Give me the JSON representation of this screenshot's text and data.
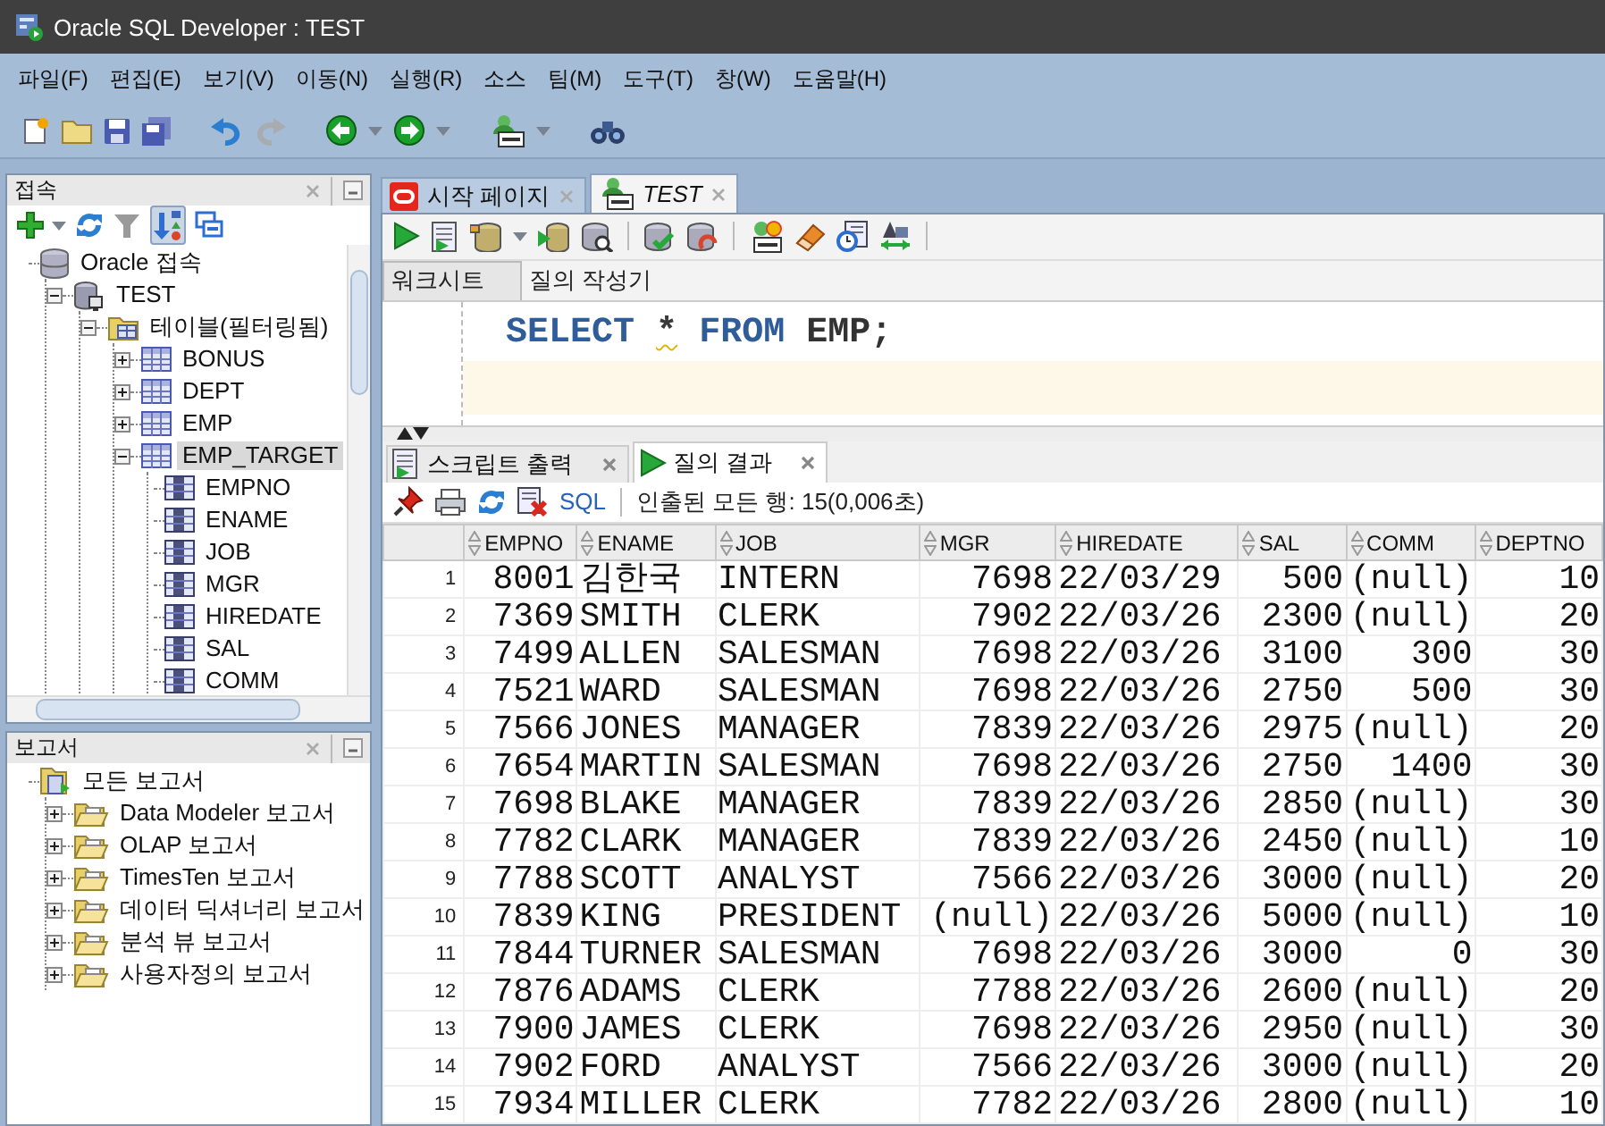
{
  "window": {
    "title": "Oracle SQL Developer : TEST"
  },
  "menu": [
    "파일(F)",
    "편집(E)",
    "보기(V)",
    "이동(N)",
    "실행(R)",
    "소스",
    "팀(M)",
    "도구(T)",
    "창(W)",
    "도움말(H)"
  ],
  "connections_panel": {
    "title": "접속",
    "tree": [
      {
        "label": "Oracle 접속",
        "kind": "database",
        "selected": false,
        "children": [
          {
            "label": "TEST",
            "kind": "connection",
            "selected": false,
            "expanded": true,
            "children": [
              {
                "label": "테이블(필터링됨)",
                "kind": "table-folder",
                "selected": false,
                "expanded": true,
                "children": [
                  {
                    "label": "BONUS",
                    "kind": "table",
                    "selected": false,
                    "expanded": false
                  },
                  {
                    "label": "DEPT",
                    "kind": "table",
                    "selected": false,
                    "expanded": false
                  },
                  {
                    "label": "EMP",
                    "kind": "table",
                    "selected": false,
                    "expanded": false
                  },
                  {
                    "label": "EMP_TARGET",
                    "kind": "table",
                    "selected": true,
                    "expanded": true,
                    "children": [
                      {
                        "label": "EMPNO",
                        "kind": "column",
                        "selected": false
                      },
                      {
                        "label": "ENAME",
                        "kind": "column",
                        "selected": false
                      },
                      {
                        "label": "JOB",
                        "kind": "column",
                        "selected": false
                      },
                      {
                        "label": "MGR",
                        "kind": "column",
                        "selected": false
                      },
                      {
                        "label": "HIREDATE",
                        "kind": "column",
                        "selected": false
                      },
                      {
                        "label": "SAL",
                        "kind": "column",
                        "selected": false
                      },
                      {
                        "label": "COMM",
                        "kind": "column",
                        "selected": false
                      }
                    ]
                  }
                ]
              }
            ]
          }
        ]
      }
    ]
  },
  "reports_panel": {
    "title": "보고서",
    "tree": [
      {
        "label": "모든 보고서",
        "kind": "reports",
        "selected": false,
        "children": [
          {
            "label": "Data Modeler 보고서",
            "kind": "report-folder",
            "selected": false,
            "expanded": false
          },
          {
            "label": "OLAP 보고서",
            "kind": "report-folder",
            "selected": false,
            "expanded": false
          },
          {
            "label": "TimesTen 보고서",
            "kind": "report-folder",
            "selected": false,
            "expanded": false
          },
          {
            "label": "데이터 딕셔너리 보고서",
            "kind": "report-folder",
            "selected": false,
            "expanded": false
          },
          {
            "label": "분석 뷰 보고서",
            "kind": "report-folder",
            "selected": false,
            "expanded": false
          },
          {
            "label": "사용자정의 보고서",
            "kind": "report-folder",
            "selected": false,
            "expanded": false
          }
        ]
      }
    ]
  },
  "editor_tabs": [
    {
      "label": "시작 페이지",
      "kind": "start",
      "selected": false
    },
    {
      "label": "TEST",
      "kind": "worksheet",
      "selected": true
    }
  ],
  "worksheet_tabs": [
    {
      "label": "워크시트",
      "selected": true
    },
    {
      "label": "질의 작성기",
      "selected": false
    }
  ],
  "sql_lines": [
    {
      "current": false,
      "tokens": [
        {
          "text": "SELECT",
          "kind": "keyword",
          "warning": false
        },
        {
          "text": "*",
          "kind": "operator",
          "warning": true
        },
        {
          "text": "FROM",
          "kind": "keyword",
          "warning": false
        },
        {
          "text": "EMP;",
          "kind": "identifier",
          "warning": false
        }
      ]
    },
    {
      "current": true
    }
  ],
  "result_tabs": [
    {
      "label": "스크립트 출력",
      "kind": "script",
      "selected": false
    },
    {
      "label": "질의 결과",
      "kind": "query",
      "selected": true
    }
  ],
  "results_toolbar": {
    "sql_link": "SQL",
    "status": "인출된 모든 행: 15(0,006초)"
  },
  "grid": {
    "columns": [
      {
        "label": "EMPNO",
        "kind": "number"
      },
      {
        "label": "ENAME",
        "kind": "text"
      },
      {
        "label": "JOB",
        "kind": "text"
      },
      {
        "label": "MGR",
        "kind": "number"
      },
      {
        "label": "HIREDATE",
        "kind": "date"
      },
      {
        "label": "SAL",
        "kind": "number"
      },
      {
        "label": "COMM",
        "kind": "number"
      },
      {
        "label": "DEPTNO",
        "kind": "number"
      }
    ],
    "rows": [
      {
        "number": "1",
        "cells": [
          "8001",
          "김한국",
          "INTERN",
          "7698",
          "22/03/29",
          "500",
          "(null)",
          "10"
        ]
      },
      {
        "number": "2",
        "cells": [
          "7369",
          "SMITH",
          "CLERK",
          "7902",
          "22/03/26",
          "2300",
          "(null)",
          "20"
        ]
      },
      {
        "number": "3",
        "cells": [
          "7499",
          "ALLEN",
          "SALESMAN",
          "7698",
          "22/03/26",
          "3100",
          "300",
          "30"
        ]
      },
      {
        "number": "4",
        "cells": [
          "7521",
          "WARD",
          "SALESMAN",
          "7698",
          "22/03/26",
          "2750",
          "500",
          "30"
        ]
      },
      {
        "number": "5",
        "cells": [
          "7566",
          "JONES",
          "MANAGER",
          "7839",
          "22/03/26",
          "2975",
          "(null)",
          "20"
        ]
      },
      {
        "number": "6",
        "cells": [
          "7654",
          "MARTIN",
          "SALESMAN",
          "7698",
          "22/03/26",
          "2750",
          "1400",
          "30"
        ]
      },
      {
        "number": "7",
        "cells": [
          "7698",
          "BLAKE",
          "MANAGER",
          "7839",
          "22/03/26",
          "2850",
          "(null)",
          "30"
        ]
      },
      {
        "number": "8",
        "cells": [
          "7782",
          "CLARK",
          "MANAGER",
          "7839",
          "22/03/26",
          "2450",
          "(null)",
          "10"
        ]
      },
      {
        "number": "9",
        "cells": [
          "7788",
          "SCOTT",
          "ANALYST",
          "7566",
          "22/03/26",
          "3000",
          "(null)",
          "20"
        ]
      },
      {
        "number": "10",
        "cells": [
          "7839",
          "KING",
          "PRESIDENT",
          "(null)",
          "22/03/26",
          "5000",
          "(null)",
          "10"
        ]
      },
      {
        "number": "11",
        "cells": [
          "7844",
          "TURNER",
          "SALESMAN",
          "7698",
          "22/03/26",
          "3000",
          "0",
          "30"
        ]
      },
      {
        "number": "12",
        "cells": [
          "7876",
          "ADAMS",
          "CLERK",
          "7788",
          "22/03/26",
          "2600",
          "(null)",
          "20"
        ]
      },
      {
        "number": "13",
        "cells": [
          "7900",
          "JAMES",
          "CLERK",
          "7698",
          "22/03/26",
          "2950",
          "(null)",
          "30"
        ]
      },
      {
        "number": "14",
        "cells": [
          "7902",
          "FORD",
          "ANALYST",
          "7566",
          "22/03/26",
          "3000",
          "(null)",
          "20"
        ]
      },
      {
        "number": "15",
        "cells": [
          "7934",
          "MILLER",
          "CLERK",
          "7782",
          "22/03/26",
          "2800",
          "(null)",
          "10"
        ]
      }
    ]
  }
}
